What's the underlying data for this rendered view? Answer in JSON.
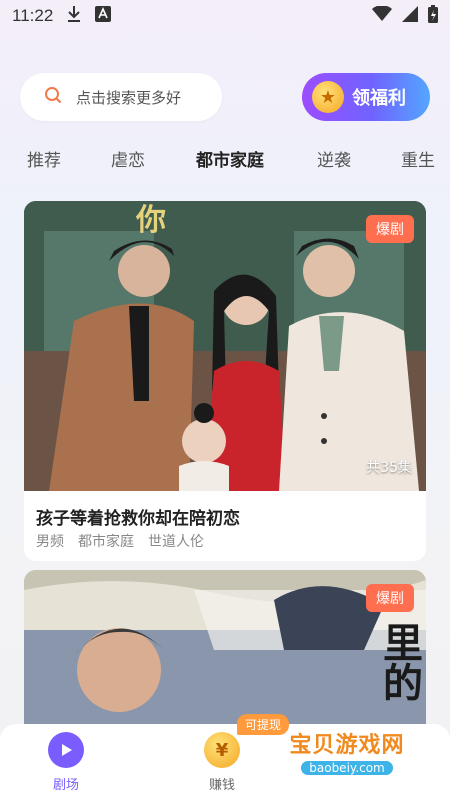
{
  "status_bar": {
    "time": "11:22"
  },
  "search": {
    "placeholder": "点击搜索更多好"
  },
  "welfare": {
    "label": "领福利",
    "accent": "#7a5cff"
  },
  "tabs": [
    {
      "label": "推荐"
    },
    {
      "label": "虐恋"
    },
    {
      "label": "都市家庭",
      "active": true
    },
    {
      "label": "逆袭"
    },
    {
      "label": "重生"
    }
  ],
  "cards": [
    {
      "badge": "爆剧",
      "poster_text": "你",
      "episodes": "共35集",
      "title": "孩子等着抢救你却在陪初恋",
      "tags": [
        "男频",
        "都市家庭",
        "世道人伦"
      ]
    },
    {
      "badge": "爆剧",
      "poster_text": "里的"
    }
  ],
  "bottom_nav": {
    "theater_label": "剧场",
    "earn_label": "赚钱",
    "withdraw_label": "可提现",
    "coin_symbol": "¥"
  },
  "watermark": {
    "title": "宝贝游戏网",
    "url": "baobeiy.com"
  },
  "colors": {
    "badge": "#ff6f4f",
    "active_nav": "#7a5cff",
    "withdraw": "#ff9a3d"
  }
}
